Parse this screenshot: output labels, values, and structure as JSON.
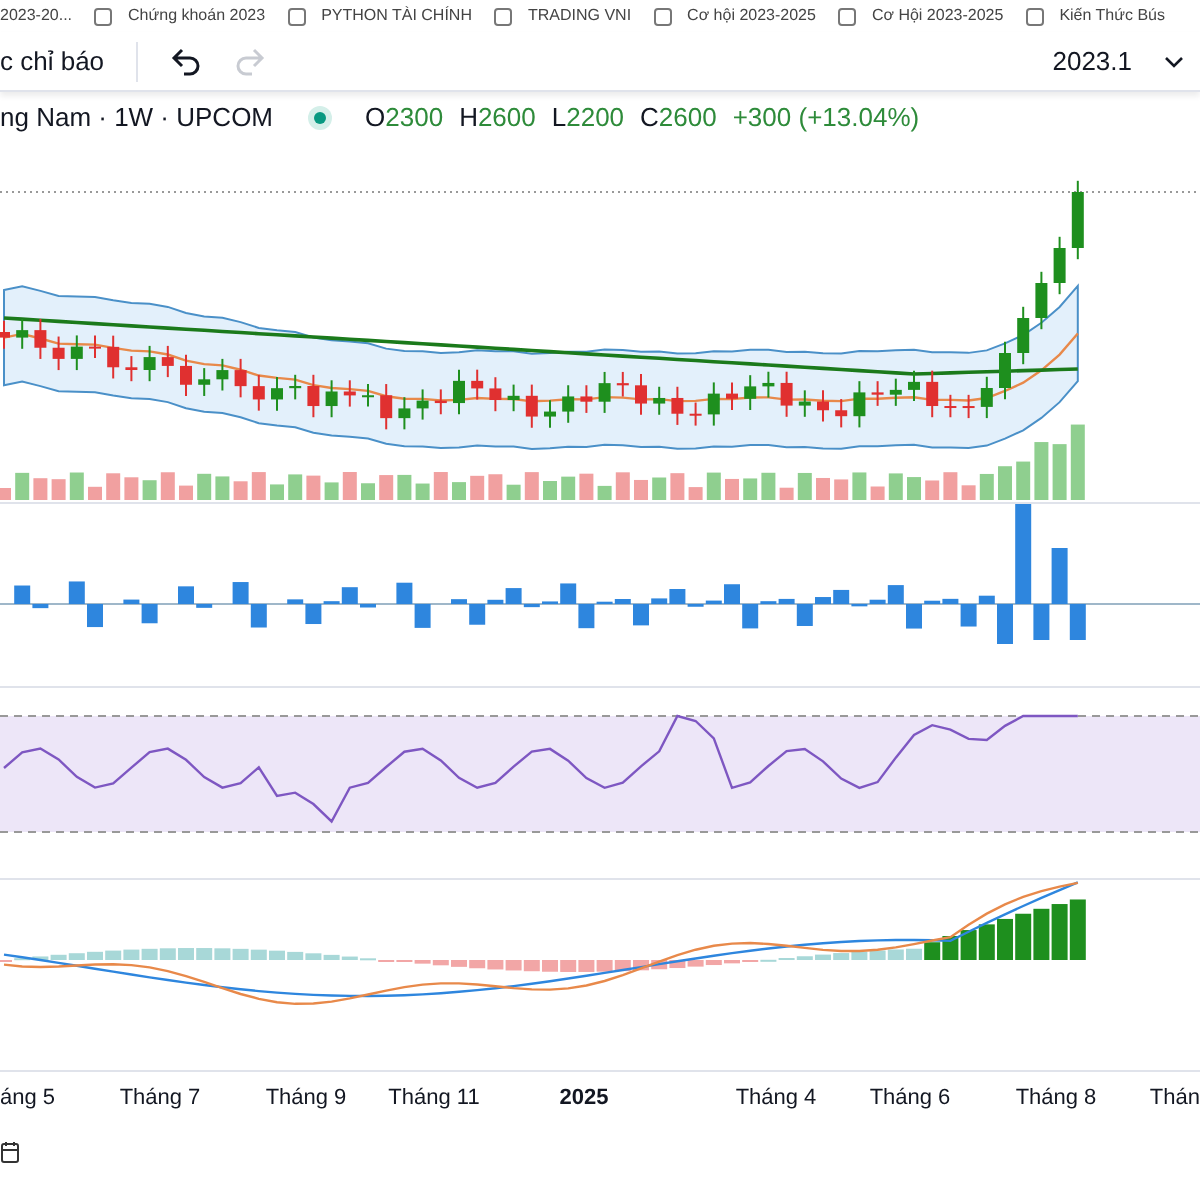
{
  "bookmarks": [
    {
      "label": "2023-20..."
    },
    {
      "label": "Chứng khoán 2023"
    },
    {
      "label": "PYTHON TÀI CHÍNH"
    },
    {
      "label": "TRADING VNI"
    },
    {
      "label": "Cơ hội 2023-2025"
    },
    {
      "label": "Cơ Hội 2023-2025"
    },
    {
      "label": "Kiến Thức Bús"
    }
  ],
  "toolbar": {
    "indicators_label": "c chỉ báo",
    "tools": [
      {
        "kind": "undo",
        "disabled": false
      },
      {
        "kind": "redo",
        "disabled": true
      }
    ],
    "range": "2023.1"
  },
  "legend": {
    "symbol": "ng Nam · 1W · UPCOM",
    "ohlc": [
      {
        "label": "O",
        "value": "2300"
      },
      {
        "label": "H",
        "value": "2600"
      },
      {
        "label": "L",
        "value": "2200"
      },
      {
        "label": "C",
        "value": "2600"
      }
    ],
    "change": "+300 (+13.04%)"
  },
  "x_axis": [
    {
      "label": "áng 5",
      "kind": "month"
    },
    {
      "label": "Tháng 7",
      "kind": "month"
    },
    {
      "label": "Tháng 9",
      "kind": "month"
    },
    {
      "label": "Tháng 11",
      "kind": "month"
    },
    {
      "label": "2025",
      "kind": "year"
    },
    {
      "label": "Tháng 4",
      "kind": "month"
    },
    {
      "label": "Tháng 6",
      "kind": "month"
    },
    {
      "label": "Tháng 8",
      "kind": "month"
    },
    {
      "label": "Thán",
      "kind": "month"
    }
  ]
}
